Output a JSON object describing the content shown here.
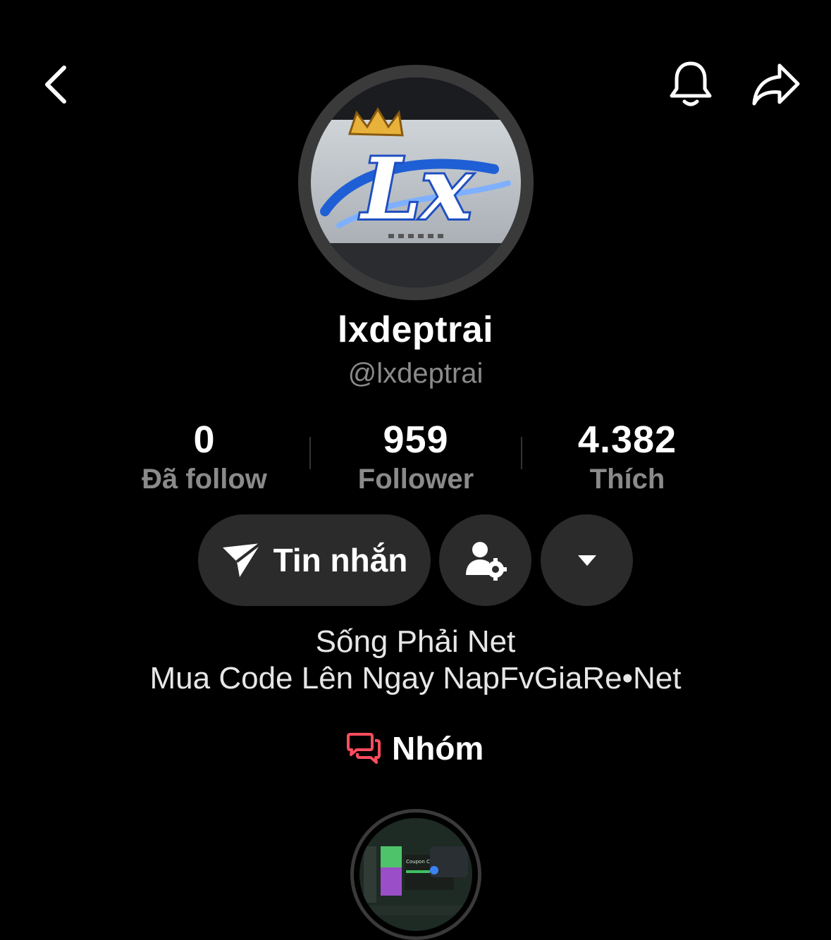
{
  "profile": {
    "display_name": "lxdeptrai",
    "handle": "@lxdeptrai",
    "avatar_text": "Lx"
  },
  "stats": [
    {
      "value": "0",
      "label": "Đã follow"
    },
    {
      "value": "959",
      "label": "Follower"
    },
    {
      "value": "4.382",
      "label": "Thích"
    }
  ],
  "actions": {
    "message_label": "Tin nhắn"
  },
  "bio": {
    "line1": "Sống Phải Net",
    "line2": "Mua Code Lên Ngay NapFvGiaRe•Net"
  },
  "group": {
    "label": "Nhóm",
    "icon_color": "#ff4d5e"
  },
  "story": {
    "thumb_text": "Coupon Code"
  },
  "icons": {
    "back": "chevron-left-icon",
    "bell": "bell-icon",
    "share": "share-icon",
    "send": "send-icon",
    "user_settings": "user-gear-icon",
    "dropdown": "caret-down-icon",
    "group": "chat-bubbles-icon"
  }
}
